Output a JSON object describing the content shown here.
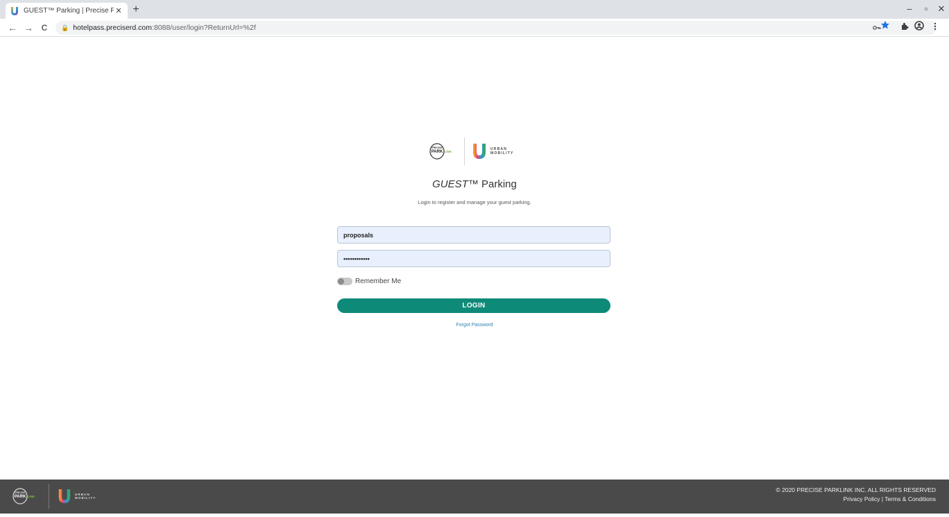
{
  "browser": {
    "tab_title": "GUEST™ Parking | Precise ParkLi",
    "tab_close": "✕",
    "new_tab": "+",
    "url_host": "hotelpass.preciserd.com",
    "url_rest": ":8088/user/login?ReturnUrl=%2f",
    "controls": {
      "minimize": "–",
      "maximize": "▫",
      "close": "✕"
    },
    "nav": {
      "back": "←",
      "forward": "→",
      "reload": "C"
    },
    "icons": [
      "key-icon",
      "star-icon",
      "extensions-icon",
      "profile-icon",
      "menu-icon"
    ],
    "accent": "#1a73e8"
  },
  "brand": {
    "ppl_top": "PRECISE",
    "ppl_main": "PARK",
    "ppl_link": "LINK",
    "um_line1": "URBAN",
    "um_line2": "MOBILITY"
  },
  "login": {
    "title_italic": "GUEST",
    "title_tm": "™ Parking",
    "subtitle": "Login to register and manage your guest parking.",
    "username_value": "proposals",
    "password_value": "••••••••••••",
    "remember_label": "Remember Me",
    "remember_on": false,
    "login_label": "LOGIN",
    "forgot_label": "Forgot Password",
    "button_color": "#0e8a78"
  },
  "footer": {
    "copyright": "© 2020 PRECISE PARKLINK INC. ALL RIGHTS RESERVED",
    "privacy": "Privacy Policy",
    "separator": " | ",
    "terms": "Terms & Conditions",
    "background": "#4a4a4a"
  }
}
